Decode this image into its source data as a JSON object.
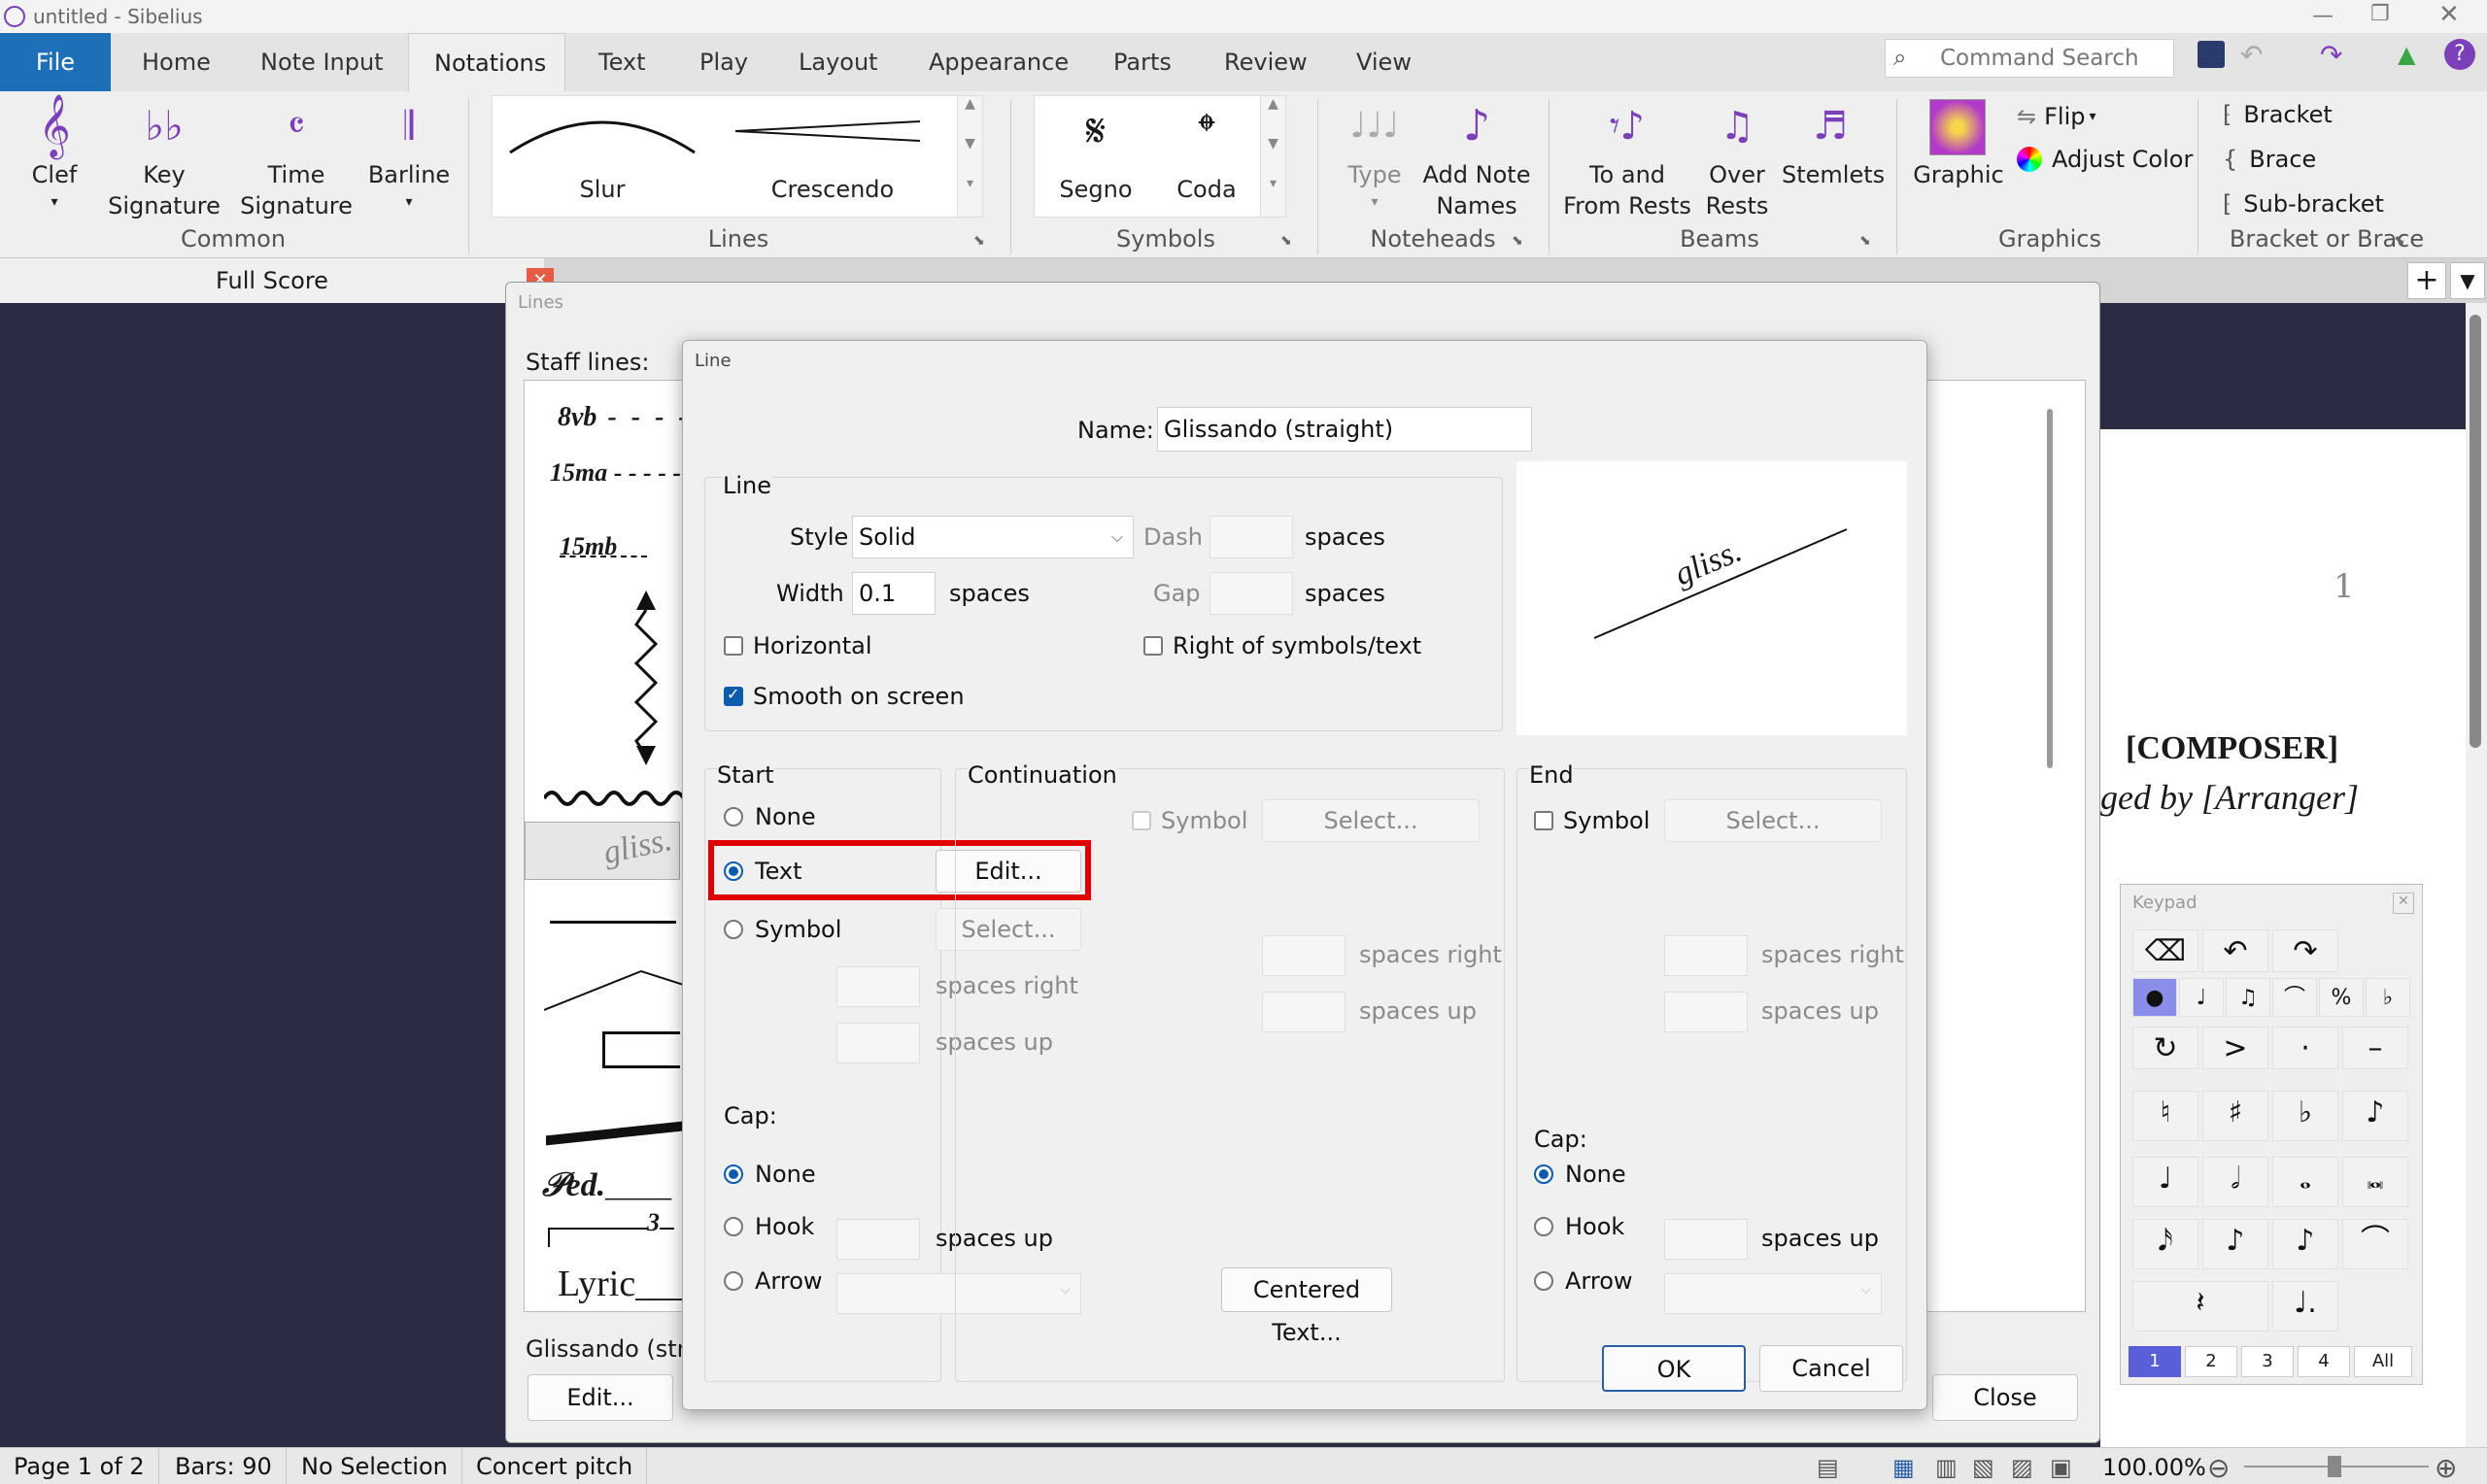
{
  "app": {
    "title": "untitled - Sibelius"
  },
  "tabs": [
    "File",
    "Home",
    "Note Input",
    "Notations",
    "Text",
    "Play",
    "Layout",
    "Appearance",
    "Parts",
    "Review",
    "View"
  ],
  "active_tab": "Notations",
  "command_search": {
    "placeholder": "Command Search"
  },
  "ribbon": {
    "common": {
      "label": "Common",
      "clef": "Clef",
      "key_sig": [
        "Key",
        "Signature"
      ],
      "time_sig": [
        "Time",
        "Signature"
      ],
      "barline": "Barline"
    },
    "lines": {
      "label": "Lines",
      "items": [
        "Slur",
        "Crescendo"
      ]
    },
    "symbols": {
      "label": "Symbols",
      "items": [
        "Segno",
        "Coda"
      ]
    },
    "noteheads": {
      "label": "Noteheads",
      "type": "Type",
      "add_names": [
        "Add Note",
        "Names"
      ]
    },
    "beams": {
      "label": "Beams",
      "to_from": [
        "To and",
        "From Rests"
      ],
      "over": [
        "Over",
        "Rests"
      ],
      "stemlets": "Stemlets"
    },
    "graphics": {
      "label": "Graphics",
      "graphic": "Graphic",
      "flip": "Flip",
      "adjust": "Adjust Color"
    },
    "bracket": {
      "label": "Bracket or Brace",
      "bracket": "Bracket",
      "brace": "Brace",
      "sub": "Sub-bracket"
    }
  },
  "score_tab": "Full Score",
  "score": {
    "page_num": "1",
    "composer": "[COMPOSER]",
    "arranger": "ged by [Arranger]"
  },
  "lines_dialog": {
    "title": "Lines",
    "staff_lines_label": "Staff lines:",
    "items": [
      "8vb",
      "15ma",
      "15mb",
      "gliss.",
      "3",
      "Lyric"
    ],
    "selected_name": "Glissando (strai",
    "edit": "Edit...",
    "close": "Close"
  },
  "line_dialog": {
    "title": "Line",
    "name_label": "Name:",
    "name_value": "Glissando (straight)",
    "line_group": "Line",
    "style_label": "Style",
    "style_value": "Solid",
    "dash_label": "Dash",
    "gap_label": "Gap",
    "width_label": "Width",
    "width_value": "0.1",
    "spaces": "spaces",
    "horizontal": "Horizontal",
    "right_of": "Right of symbols/text",
    "smooth": "Smooth on screen",
    "preview_text": "gliss.",
    "start": {
      "title": "Start",
      "none": "None",
      "text": "Text",
      "symbol": "Symbol",
      "edit": "Edit...",
      "select": "Select...",
      "spaces_right": "spaces right",
      "spaces_up": "spaces up"
    },
    "cap": {
      "title": "Cap:",
      "none": "None",
      "hook": "Hook",
      "arrow": "Arrow",
      "spaces_up": "spaces up"
    },
    "continuation": {
      "title": "Continuation",
      "symbol": "Symbol",
      "select": "Select...",
      "spaces_right": "spaces right",
      "spaces_up": "spaces up",
      "centered": "Centered Text..."
    },
    "end": {
      "title": "End",
      "symbol": "Symbol",
      "select": "Select...",
      "spaces_right": "spaces right",
      "spaces_up": "spaces up"
    },
    "ok": "OK",
    "cancel": "Cancel"
  },
  "keypad": {
    "title": "Keypad",
    "tabs": [
      "1",
      "2",
      "3",
      "4",
      "All"
    ]
  },
  "status": {
    "page": "Page 1 of 2",
    "bars": "Bars: 90",
    "selection": "No Selection",
    "pitch": "Concert pitch",
    "zoom": "100.00%"
  },
  "colors": {
    "accent": "#2a5fa6",
    "highlight": "#e00000",
    "active_tab_bg": "#efefef",
    "file_tab": "#1f6fb8"
  }
}
